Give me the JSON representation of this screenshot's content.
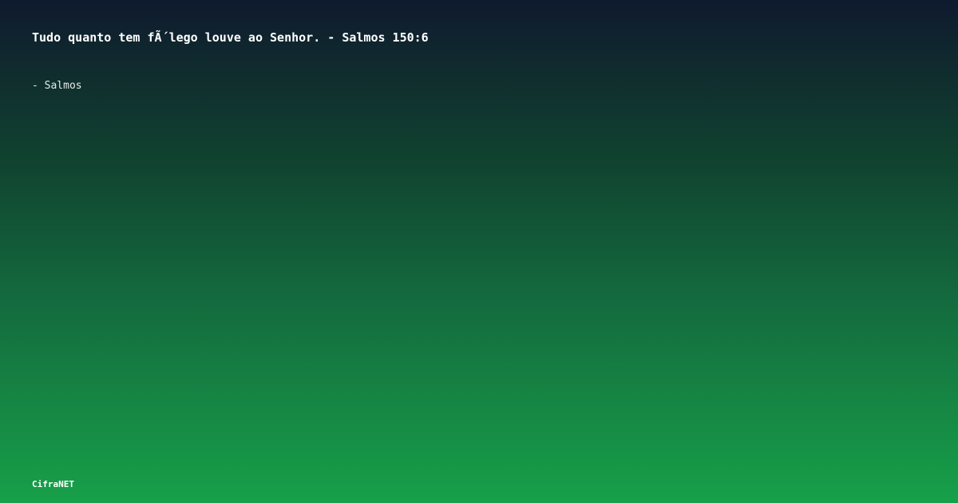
{
  "card": {
    "quote": "Tudo quanto tem fÃ´lego louve ao Senhor. - Salmos 150:6",
    "author": "- Salmos",
    "brand": "CifraNET"
  },
  "colors": {
    "gradient_top": "#0f1a2e",
    "gradient_bottom": "#17a049",
    "text": "#ffffff"
  }
}
